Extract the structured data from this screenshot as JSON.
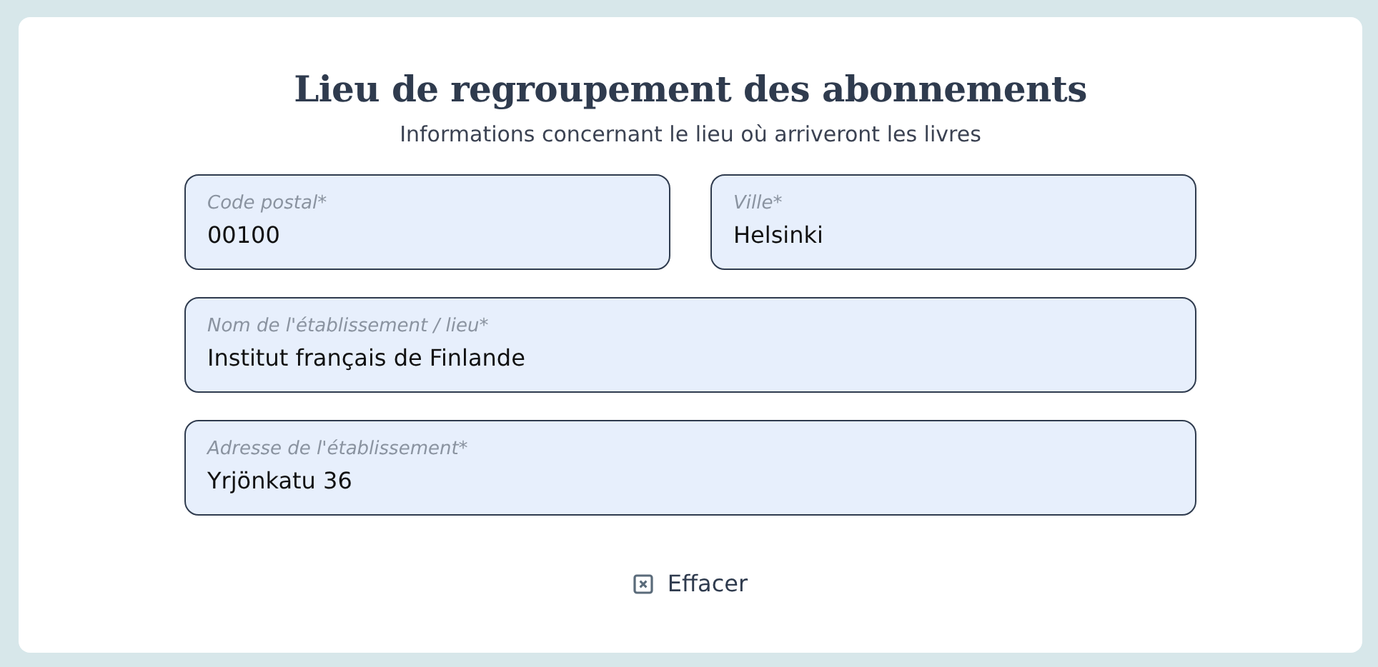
{
  "title": "Lieu de regroupement des abonnements",
  "subtitle": "Informations concernant le lieu où arriveront les livres",
  "rows": [
    [
      {
        "label": "Code postal*",
        "value": "00100"
      },
      {
        "label": "Ville*",
        "value": "Helsinki"
      }
    ],
    [
      {
        "label": "Nom de l'établissement / lieu*",
        "value": "Institut français de Finlande"
      }
    ],
    [
      {
        "label": "Adresse de l'établissement*",
        "value": "Yrjönkatu 36"
      }
    ]
  ],
  "clear_button": {
    "label": "Effacer"
  }
}
